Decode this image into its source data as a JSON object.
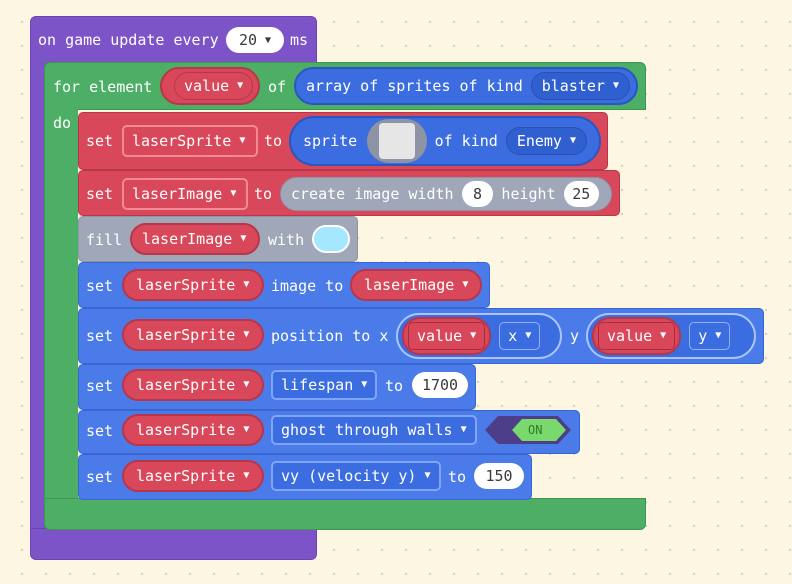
{
  "colors": {
    "event": "#7c54c8",
    "loop": "#4caf65",
    "sprite": "#4a7be8",
    "variable": "#d9485a",
    "image": "#a0a7b8",
    "toggle_bg": "#4c3e88",
    "toggle_on": "#79d96c",
    "workspace": "#fdf6e3"
  },
  "event_block": {
    "prefix": "on game update every",
    "interval": "20",
    "suffix": "ms"
  },
  "for_block": {
    "label": "for element",
    "variable": "value",
    "of_label": "of",
    "array_label": "array of sprites of kind",
    "kind": "blaster",
    "do_label": "do"
  },
  "statements": {
    "s1": {
      "set": "set",
      "variable": "laserSprite",
      "to": "to",
      "sprite_label": "sprite",
      "of_kind_label": "of kind",
      "kind": "Enemy"
    },
    "s2": {
      "set": "set",
      "variable": "laserImage",
      "to": "to",
      "create_label": "create image width",
      "width": "8",
      "height_label": "height",
      "height": "25"
    },
    "s3": {
      "fill": "fill",
      "variable": "laserImage",
      "with": "with"
    },
    "s4": {
      "set": "set",
      "variable": "laserSprite",
      "image_to": "image to",
      "value_var": "laserImage"
    },
    "s5": {
      "set": "set",
      "variable": "laserSprite",
      "position_label": "position to x",
      "x_var": "value",
      "x_prop": "x",
      "y_label": "y",
      "y_var": "value",
      "y_prop": "y"
    },
    "s6": {
      "set": "set",
      "variable": "laserSprite",
      "property": "lifespan",
      "to": "to",
      "value": "1700"
    },
    "s7": {
      "set": "set",
      "variable": "laserSprite",
      "flag": "ghost through walls",
      "toggle": "ON"
    },
    "s8": {
      "set": "set",
      "variable": "laserSprite",
      "property": "vy (velocity y)",
      "to": "to",
      "value": "150"
    }
  }
}
